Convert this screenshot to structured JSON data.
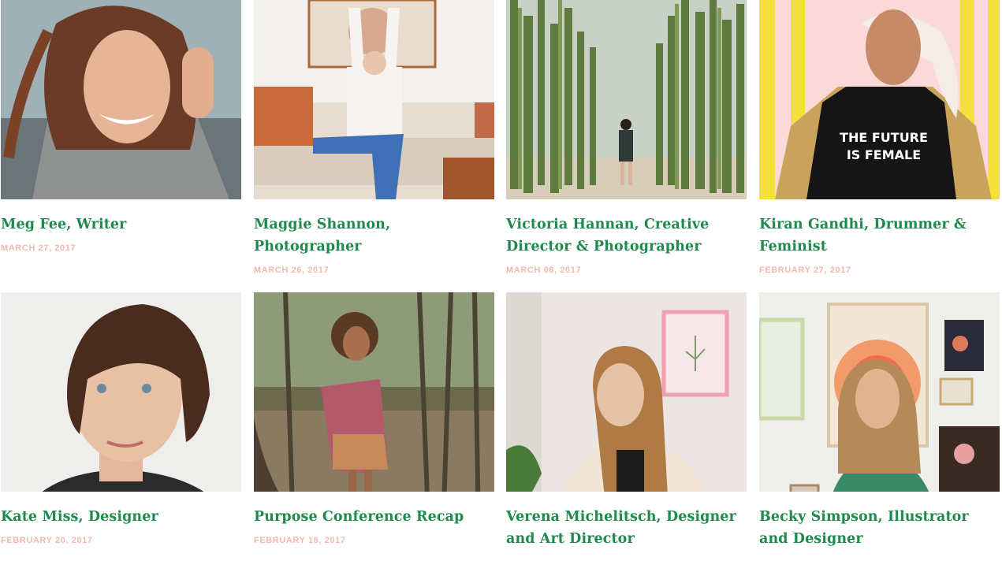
{
  "posts": [
    {
      "title": "Meg Fee, Writer",
      "date": "MARCH 27, 2017",
      "photo": "portrait-woman-scarf"
    },
    {
      "title": "Maggie Shannon, Photographer",
      "date": "MARCH 26, 2017",
      "photo": "woman-on-sofa"
    },
    {
      "title": "Victoria Hannan, Creative Director & Photographer",
      "date": "MARCH 08, 2017",
      "photo": "cactus-corridor"
    },
    {
      "title": "Kiran Gandhi, Drummer & Feminist",
      "date": "FEBRUARY 27, 2017",
      "photo": "future-is-female-tshirt",
      "photo_text": [
        "THE FUTURE",
        "IS FEMALE"
      ]
    },
    {
      "title": "Kate Miss, Designer",
      "date": "FEBRUARY 20, 2017",
      "photo": "portrait-short-hair"
    },
    {
      "title": "Purpose Conference Recap",
      "date": "FEBRUARY 18, 2017",
      "photo": "woman-in-forest"
    },
    {
      "title": "Verena Michelitsch, Designer and Art Director",
      "date": "",
      "photo": "woman-pink-wall"
    },
    {
      "title": "Becky Simpson, Illustrator and Designer",
      "date": "",
      "photo": "woman-art-wall"
    }
  ],
  "colors": {
    "title": "#1f8a4c",
    "date": "#f2b8ae"
  }
}
